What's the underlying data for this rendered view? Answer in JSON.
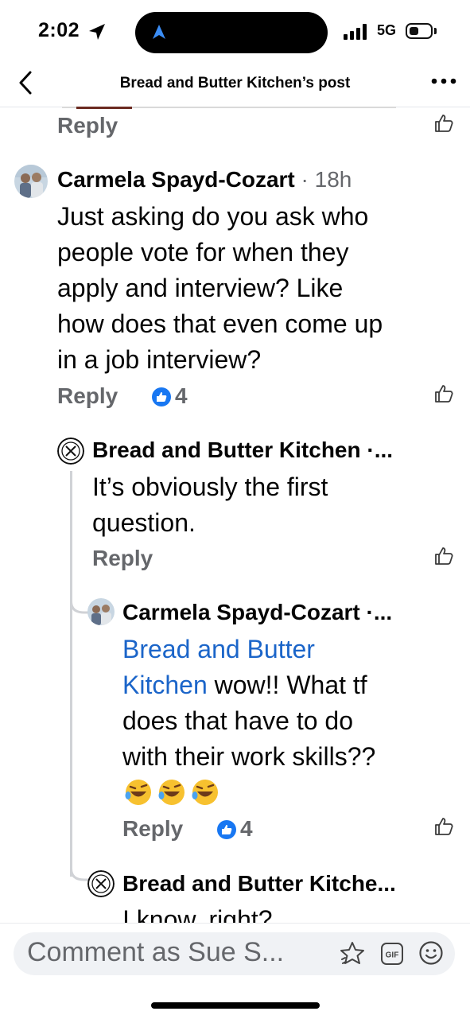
{
  "status": {
    "time": "2:02",
    "network": "5G"
  },
  "header": {
    "title": "Bread and Butter Kitchen’s post"
  },
  "comments": {
    "top_reply_label": "Reply",
    "c1": {
      "author": "Carmela Spayd-Cozart",
      "meta": " · 18h",
      "lines": [
        "Just asking do you ask who",
        "people vote for when they",
        "apply and interview? Like",
        "how does that even come up",
        "in a job interview?"
      ],
      "reply_label": "Reply",
      "reaction_count": "4"
    },
    "r1": {
      "author": "Bread and Butter Kitchen ·...",
      "lines": [
        "It’s obviously the first",
        "question."
      ],
      "reply_label": "Reply"
    },
    "r2": {
      "author": "Carmela Spayd-Cozart ·...",
      "mention_line1": "Bread and Butter",
      "mention_line2": "Kitchen",
      "line2_rest": " wow!! What tf",
      "line3": "does that have to do",
      "line4": "with their work skills??",
      "reply_label": "Reply",
      "reaction_count": "4"
    },
    "r3": {
      "author": "Bread and Butter Kitche...",
      "line1": "I know, right?"
    }
  },
  "composer": {
    "placeholder": "Comment as Sue S..."
  },
  "colors": {
    "mention": "#1b65c9",
    "like_blue": "#1877f2",
    "meta_gray": "#65676b"
  },
  "icons": [
    "location-arrow-icon",
    "signal-icon",
    "battery-icon",
    "back-chevron-icon",
    "more-icon",
    "like-outline-icon",
    "like-reaction-icon",
    "laughing-emoji-icon",
    "sticker-icon",
    "gif-icon",
    "emoji-icon"
  ]
}
